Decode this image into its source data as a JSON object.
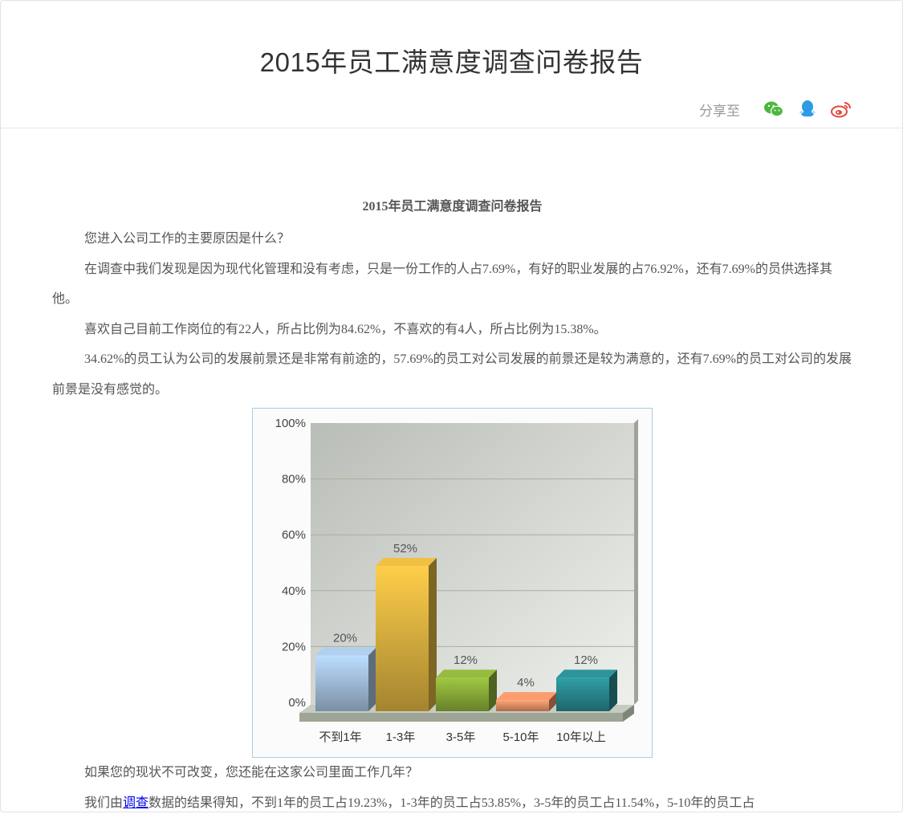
{
  "page": {
    "title": "2015年员工满意度调查问卷报告",
    "share_label": "分享至",
    "share_icons": [
      "wechat-icon",
      "qq-icon",
      "weibo-icon"
    ],
    "colors": {
      "wechat": "#4bb73d",
      "qq": "#2f9be6",
      "weibo": "#e4473a"
    }
  },
  "article": {
    "title": "2015年员工满意度调查问卷报告",
    "q1": "您进入公司工作的主要原因是什么？",
    "p1": "在调查中我们发现是因为现代化管理和没有考虑，只是一份工作的人占7.69%，有好的职业发展的占76.92%，还有7.69%的员供选择其他。",
    "p2": "喜欢自己目前工作岗位的有22人，所占比例为84.62%，不喜欢的有4人，所占比例为15.38%。",
    "p3": "34.62%的员工认为公司的发展前景还是非常有前途的，57.69%的员工对公司发展的前景还是较为满意的，还有7.69%的员工对公司的发展前景是没有感觉的。",
    "q2": "如果您的现状不可改变，您还能在这家公司里面工作几年？",
    "p4_prefix": "我们由",
    "p4_link": "调查",
    "p4_rest": "数据的结果得知，不到1年的员工占19.23%，1-3年的员工占53.85%，3-5年的员工占11.54%，5-10年的员工占"
  },
  "chart_data": {
    "type": "bar",
    "categories": [
      "不到1年",
      "1-3年",
      "3-5年",
      "5-10年",
      "10年以上"
    ],
    "values": [
      20,
      52,
      12,
      4,
      12
    ],
    "value_labels": [
      "20%",
      "52%",
      "12%",
      "4%",
      "12%"
    ],
    "yticks": [
      "0%",
      "20%",
      "40%",
      "60%",
      "80%",
      "100%"
    ],
    "ylim": [
      0,
      100
    ],
    "colors": [
      "#a9c6e4",
      "#e3b842",
      "#8fb33b",
      "#f0956a",
      "#2a8e94"
    ],
    "grid": true
  }
}
